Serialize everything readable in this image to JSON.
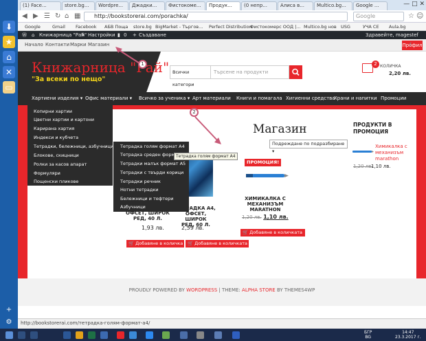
{
  "browser": {
    "tabs": [
      {
        "label": "(1) Face..."
      },
      {
        "label": "store.bg..."
      },
      {
        "label": "Wordpre..."
      },
      {
        "label": "Джадки..."
      },
      {
        "label": "Фистокоме..."
      },
      {
        "label": "Продук...",
        "active": true
      },
      {
        "label": "(0 непр..."
      },
      {
        "label": "Алиса в..."
      },
      {
        "label": "Multico.bg..."
      },
      {
        "label": "Google ..."
      }
    ],
    "url": "http://bookstorerai.com/porachka/",
    "search_placeholder": "Google",
    "bookmarks": [
      "Google",
      "Gmail",
      "Facebook",
      "АБВ Поща",
      "store.bg",
      "BigMarket - Търгов...",
      "Perfect Distribution",
      "Фистокомерс ООД |...",
      "Multico.bg нов",
      "USG",
      "УЧА СЕ",
      "Aula.bg"
    ]
  },
  "wp_admin": {
    "site": "Книжарница \"Рай\"",
    "customize": "Настройки",
    "comments": "0",
    "new": "Създаване",
    "greeting": "Здравейте, magestef"
  },
  "topnav": {
    "items": [
      "Начало",
      "Контакти",
      "Марки",
      "Магазин"
    ],
    "profile": "Профил"
  },
  "header": {
    "title": "Книжарница \"Рай\"",
    "tagline": "\"За всеки по нещо\"",
    "category_select": "Всички категори",
    "search_placeholder": "Търсене на продукти",
    "cart_count": "2",
    "cart_qty_label": "КОЛИЧКА",
    "cart_total": "2,20 лв."
  },
  "mainnav": {
    "items": [
      "Хартиени изделия ▾",
      "Офис материали ▾",
      "Всичко за ученика ▾",
      "Арт материали",
      "Книги и помагала",
      "Хигиенни средства",
      "Храни и напитки",
      "Промоции"
    ]
  },
  "dropdown1": {
    "items": [
      "Копирни хартии",
      "Цветни хартии и картони",
      "Карирана хартия",
      "Индекси и кубчета",
      "Тетрадки, бележници, азбучници ▸",
      "Блокове, скицници",
      "Ролки за касов апарат",
      "Формуляри",
      "Пощенски пликове"
    ]
  },
  "dropdown2": {
    "items": [
      "Тетрадка голям формат А4",
      "Тетрадка среден формат",
      "Тетрадки малък формат А5",
      "Тетрадки с твърди корици",
      "Тетрадки речник",
      "Нотни тетрадки",
      "Бележници и тефтери",
      "Азбучници"
    ],
    "tooltip": "Тетрадка голям формат А4"
  },
  "page": {
    "title": "Магазин",
    "sort": "Подреждане по подразбиране ▾"
  },
  "products": [
    {
      "title_1": "ОФСЕТ, ШИРОК",
      "title_2": "РЕД, 40 Л.",
      "price": "1,93 лв.",
      "button": "Добавяне в количка"
    },
    {
      "title_1": "ТЕТРАДКА А4,",
      "title_2": "ОФСЕТ, ШИРОК",
      "title_3": "РЕД, 60 Л.",
      "price": "2,59 лв.",
      "button": "Добавяне в количката"
    },
    {
      "title_1": "ХИМИКАЛКА С",
      "title_2": "МЕХАНИЗЪМ",
      "title_3": "MARATHON",
      "price_old": "1,20 лв.",
      "price": "1,10 лв.",
      "badge": "ПРОМОЦИЯ!",
      "button": "Добавяне в количката"
    }
  ],
  "sidebar": {
    "heading_1": "ПРОДУКТИ В",
    "heading_2": "ПРОМОЦИЯ",
    "product_1": "Химикалка с",
    "product_2": "механизъм",
    "product_3": "marathon",
    "price_old": "1,20 лв.",
    "price": "1,10 лв."
  },
  "annotations": {
    "m1": "1",
    "m2": "2"
  },
  "footer": {
    "p1": "PROUDLY POWERED BY ",
    "wp": "WORDPRESS",
    "p2": " | THEME: ",
    "theme": "ALPHA STORE",
    "p3": " BY THEMES4WP"
  },
  "status": {
    "url": "http://bookstorerai.com/тетрадка-голям-формат-а4/"
  },
  "taskbar": {
    "lang": "БГР",
    "layout": "BG",
    "time": "14:47",
    "date": "23.3.2017 г."
  },
  "colors": {
    "accent": "#e8262b",
    "dark": "#2b2b2b",
    "tagline": "#f2d31a",
    "toolbar": "#1c5ea8"
  }
}
